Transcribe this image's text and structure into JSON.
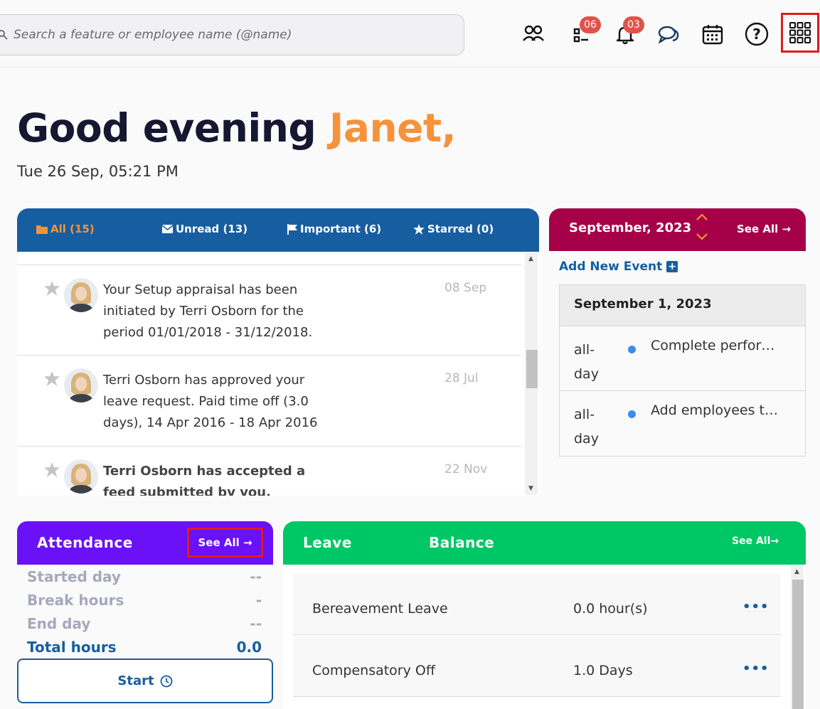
{
  "search": {
    "placeholder": "Search a feature or employee name (@name)"
  },
  "topbar": {
    "tasks_badge": "06",
    "notifications_badge": "03"
  },
  "greeting": {
    "prefix": "Good evening ",
    "name": "Janet,",
    "datetime": "Tue 26 Sep, 05:21 PM"
  },
  "messages": {
    "tabs": [
      {
        "label": "All (15)"
      },
      {
        "label": "Unread (13)"
      },
      {
        "label": "Important (6)"
      },
      {
        "label": "Starred (0)"
      }
    ],
    "items": [
      {
        "text": "Your Setup appraisal has been initiated by Terri Osborn for the period 01/01/2018 - 31/12/2018.",
        "date": "08 Sep"
      },
      {
        "text": "Terri Osborn has approved your leave request. Paid time off (3.0 days), 14 Apr 2016 - 18 Apr 2016",
        "date": "28 Jul"
      },
      {
        "text": "Terri Osborn has accepted a feed submitted bv vou.",
        "date": "22 Nov"
      }
    ]
  },
  "calendar": {
    "month": "September, 2023",
    "see_all": "See All →",
    "add_event": "Add New Event",
    "date_header": "September 1, 2023",
    "events": [
      {
        "when": "all-day",
        "title": "Complete perfor…"
      },
      {
        "when": "all-day",
        "title": "Add employees t…"
      }
    ]
  },
  "attendance": {
    "title": "Attendance",
    "see_all": "See All →",
    "rows": [
      {
        "label": "Started day",
        "value": "--"
      },
      {
        "label": "Break hours",
        "value": "-"
      },
      {
        "label": "End day",
        "value": "--"
      },
      {
        "label": "Total hours",
        "value": "0.0"
      }
    ],
    "start_label": "Start"
  },
  "leave": {
    "title_1": "Leave",
    "title_2": "Balance",
    "see_all": "See All→",
    "rows": [
      {
        "name": "Bereavement Leave",
        "amount": "0.0 hour(s)"
      },
      {
        "name": "Compensatory Off",
        "amount": "1.0 Days"
      }
    ]
  },
  "colors": {
    "primary_blue": "#175ea0",
    "orange": "#f6933a",
    "calendar_head": "#a50048",
    "attendance_head": "#6a11f7",
    "leave_head": "#00c765",
    "badge_red": "#e0524a"
  }
}
